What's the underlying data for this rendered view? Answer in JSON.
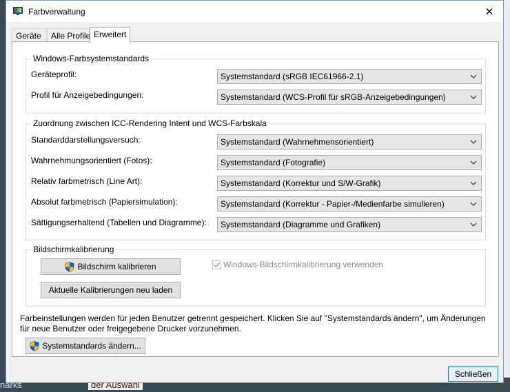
{
  "window": {
    "title": "Farbverwaltung",
    "close_glyph": "✕"
  },
  "tabs": [
    {
      "label": "Geräte"
    },
    {
      "label": "Alle Profile"
    },
    {
      "label": "Erweitert"
    }
  ],
  "wcs_defaults": {
    "title": "Windows-Farbsystemstandards",
    "device_profile_label": "Geräteprofil:",
    "device_profile_value": "Systemstandard (sRGB IEC61966-2.1)",
    "viewing_conditions_label": "Profil für Anzeigebedingungen:",
    "viewing_conditions_value": "Systemstandard (WCS-Profil für sRGB-Anzeigebedingungen)"
  },
  "icc_mapping": {
    "title": "Zuordnung zwischen ICC-Rendering Intent und WCS-Farbskala",
    "rows": [
      {
        "label": "Standarddarstellungsversuch:",
        "value": "Systemstandard (Wahrnehmensorientiert)"
      },
      {
        "label": "Wahrnehmungsorientiert (Fotos):",
        "value": "Systemstandard (Fotografie)"
      },
      {
        "label": "Relativ farbmetrisch (Line Art):",
        "value": "Systemstandard (Korrektur und S/W-Grafik)"
      },
      {
        "label": "Absolut farbmetrisch (Papiersimulation):",
        "value": "Systemstandard (Korrektur - Papier-/Medienfarbe simulieren)"
      },
      {
        "label": "Sättigungserhaltend (Tabellen und Diagramme):",
        "value": "Systemstandard (Diagramme und Grafiken)"
      }
    ]
  },
  "calibration": {
    "title": "Bildschirmkalibrierung",
    "calibrate_label": "Bildschirm kalibrieren",
    "reload_label": "Aktuelle Kalibrierungen neu laden",
    "use_windows_calibration_label": "Windows-Bildschirmkalibrierung verwenden",
    "use_windows_calibration_checked": true
  },
  "info_text": "Farbeinstellungen werden für jeden Benutzer getrennt gespeichert. Klicken Sie auf \"Systemstandards ändern\", um Änderungen für neue Benutzer oder freigegebene Drucker vorzunehmen.",
  "change_defaults_label": "Systemstandards ändern...",
  "close_label": "Schließen",
  "background": {
    "left_text": "narks",
    "bottom_text": "der Auswahl"
  }
}
